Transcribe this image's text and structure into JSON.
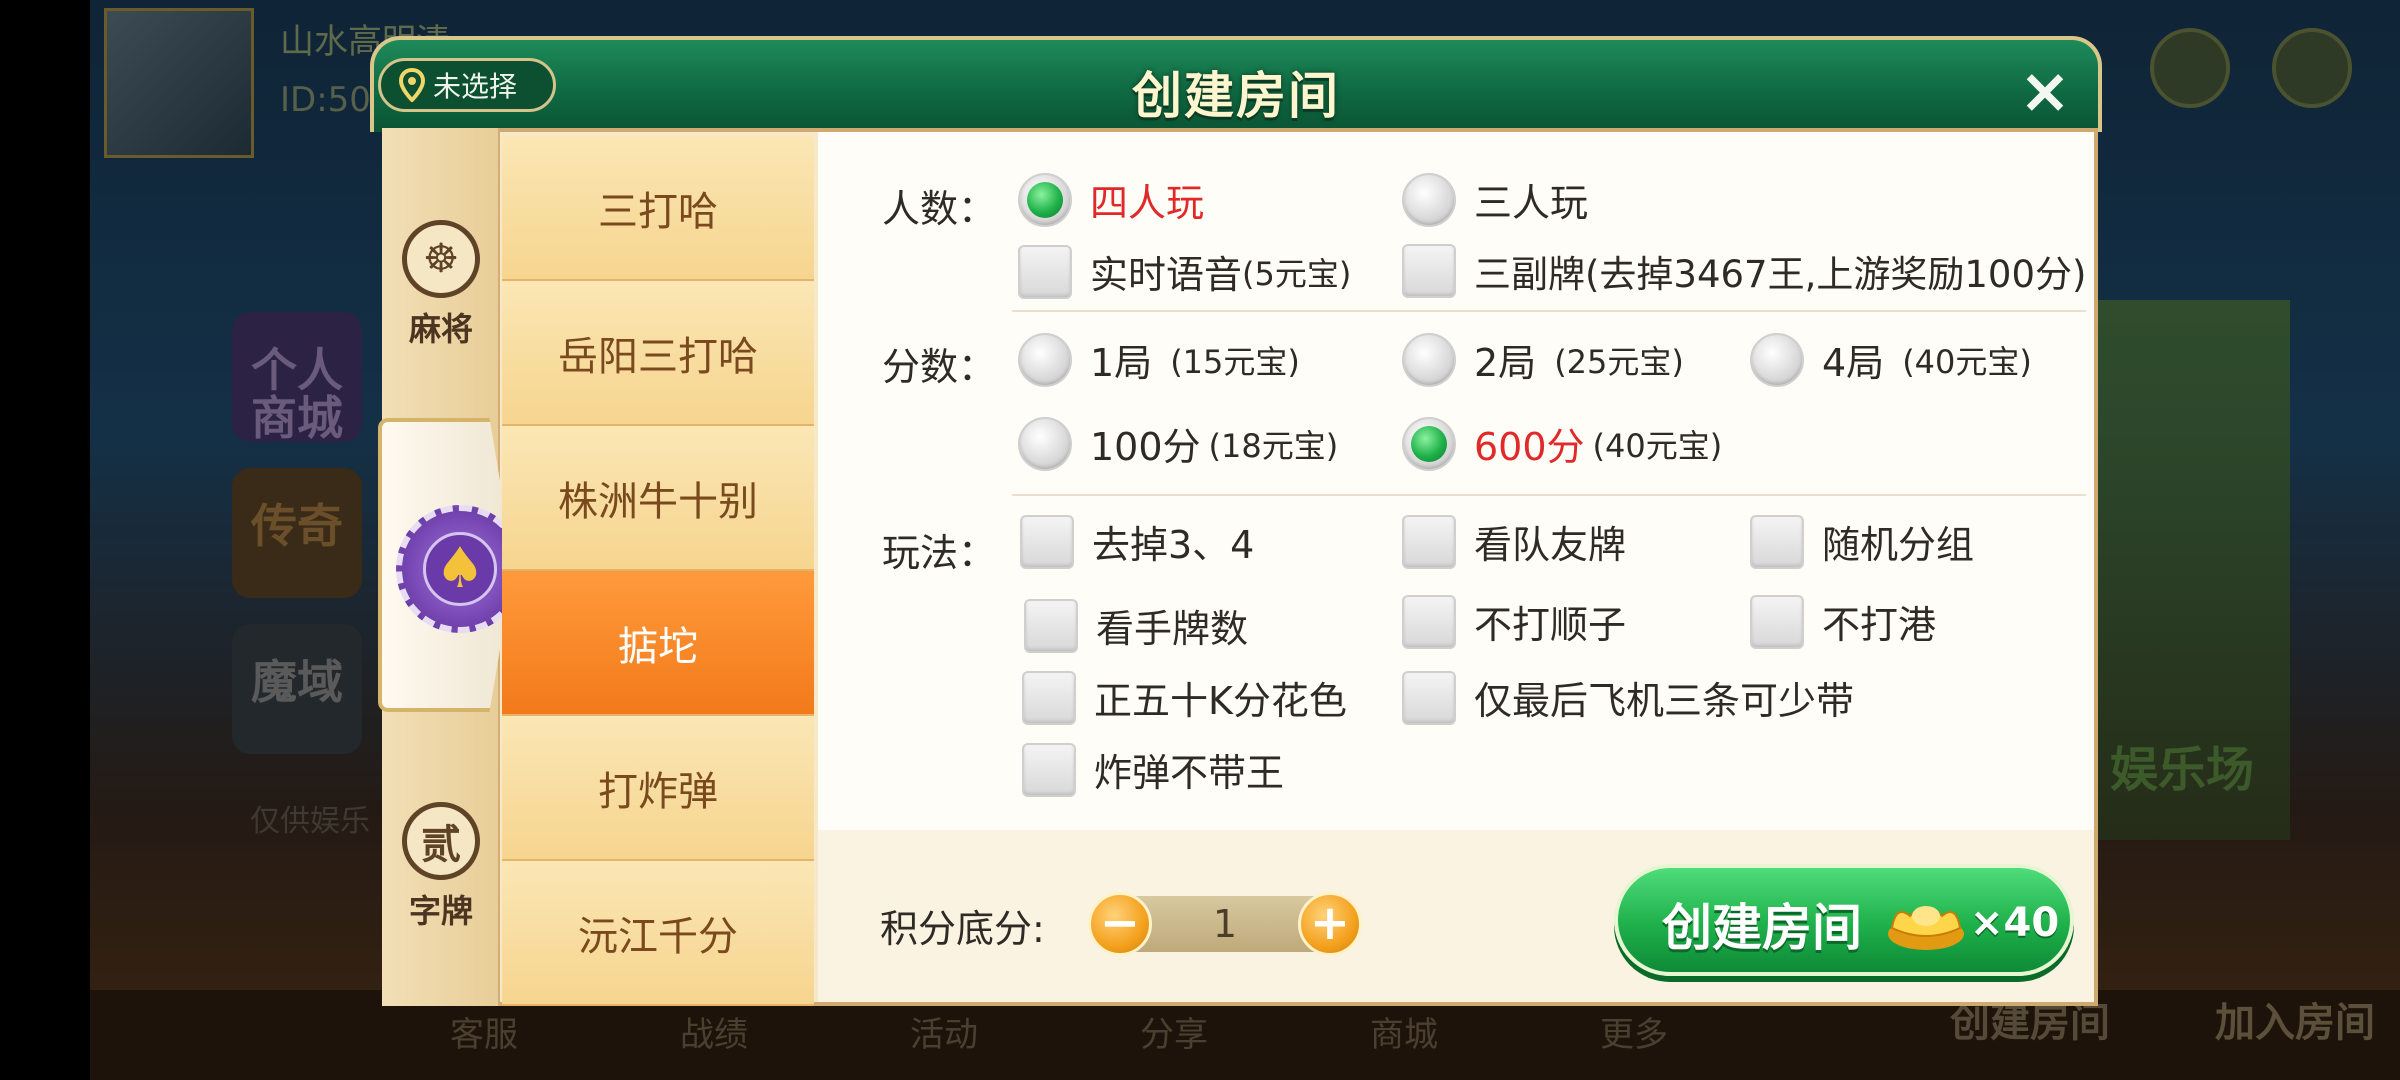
{
  "background": {
    "player_name": "山水高明清",
    "player_id": "ID:50",
    "left_buttons": [
      "个人商城",
      "传奇",
      "魔域"
    ],
    "bottom_items": [
      "客服",
      "战绩",
      "活动",
      "分享",
      "商城",
      "更多"
    ],
    "right_area_label": "娱乐场",
    "create_room": "创建房间",
    "join_room": "加入房间",
    "disclaimer": "仅供娱乐"
  },
  "dialog": {
    "title": "创建房间",
    "location_label": "未选择",
    "close": "×"
  },
  "categories": [
    {
      "icon": "☸",
      "label": "麻将"
    },
    {
      "icon": "♠",
      "label": ""
    },
    {
      "icon": "贰",
      "label": "字牌"
    }
  ],
  "games": [
    {
      "label": "三打哈",
      "active": false
    },
    {
      "label": "岳阳三打哈",
      "active": false
    },
    {
      "label": "株洲牛十别",
      "active": false
    },
    {
      "label": "掂坨",
      "active": true
    },
    {
      "label": "打炸弹",
      "active": false
    },
    {
      "label": "沅江千分",
      "active": false
    }
  ],
  "options": {
    "players": {
      "label": "人数：",
      "radios": [
        {
          "text": "四人玩",
          "selected": true
        },
        {
          "text": "三人玩",
          "selected": false
        }
      ],
      "checks": [
        {
          "text": "实时语音",
          "sub": "(5元宝)"
        },
        {
          "text": "三副牌(去掉3467王,上游奖励100分)",
          "sub": ""
        }
      ]
    },
    "score": {
      "label": "分数：",
      "radios": [
        {
          "text": "1局",
          "sub": "(15元宝)",
          "selected": false
        },
        {
          "text": "2局",
          "sub": "(25元宝)",
          "selected": false
        },
        {
          "text": "4局",
          "sub": "(40元宝)",
          "selected": false
        },
        {
          "text": "100分",
          "sub": "(18元宝)",
          "selected": false
        },
        {
          "text": "600分",
          "sub": "(40元宝)",
          "selected": true
        }
      ]
    },
    "rules": {
      "label": "玩法：",
      "checks": [
        "去掉3、4",
        "看队友牌",
        "随机分组",
        "看手牌数",
        "不打顺子",
        "不打港",
        "正五十K分花色",
        "仅最后飞机三条可少带",
        "炸弹不带王"
      ]
    }
  },
  "footer": {
    "base_label": "积分底分:",
    "minus": "−",
    "plus": "+",
    "base_value": "1",
    "create_label": "创建房间",
    "cost": "×40"
  },
  "colors": {
    "header_green": "#0f6a42",
    "active_tab": "#f27a1a",
    "selected_text": "#e02a2a",
    "create_button": "#1eb04b"
  }
}
